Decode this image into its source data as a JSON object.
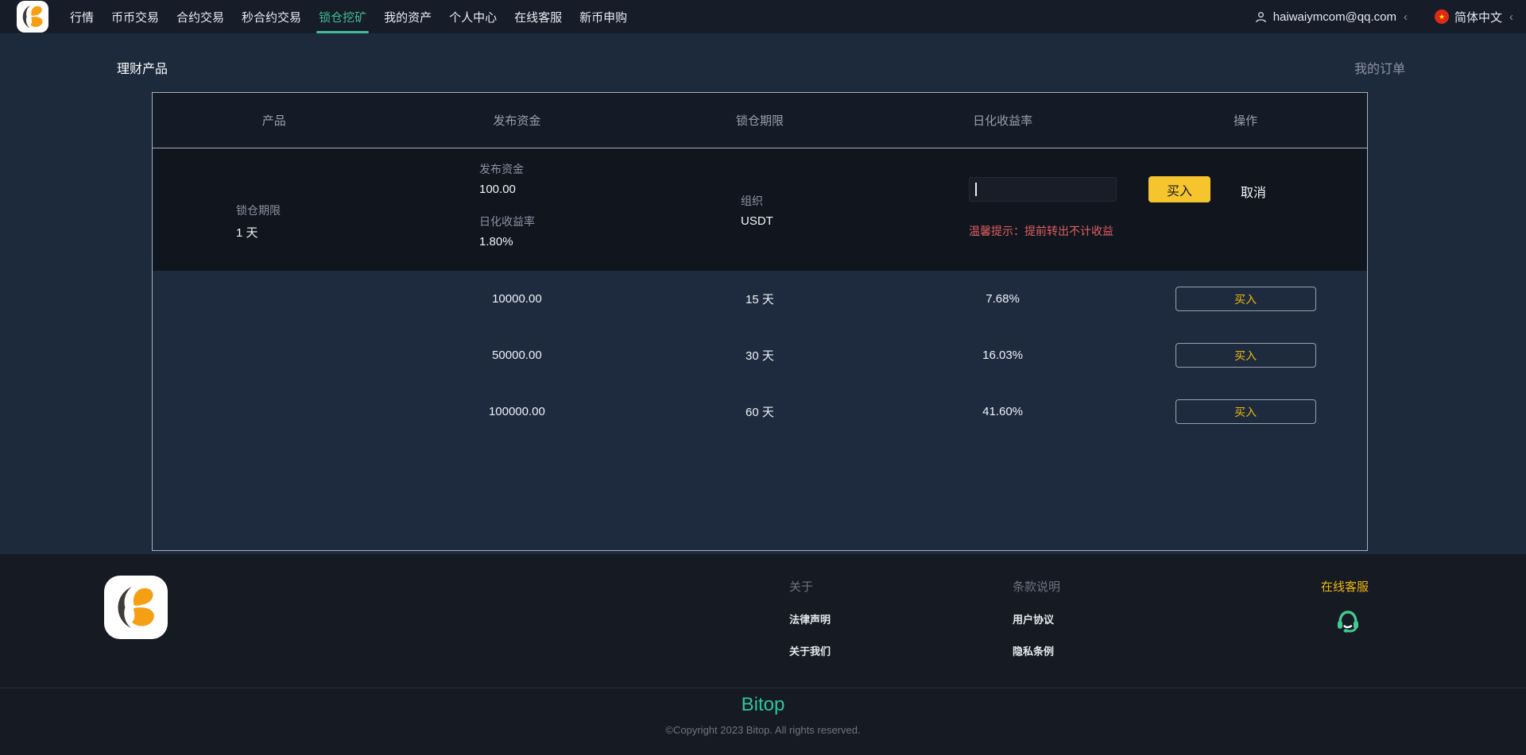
{
  "navbar": {
    "items": [
      {
        "label": "行情",
        "active": false
      },
      {
        "label": "币币交易",
        "active": false
      },
      {
        "label": "合约交易",
        "active": false
      },
      {
        "label": "秒合约交易",
        "active": false
      },
      {
        "label": "锁仓挖矿",
        "active": true
      },
      {
        "label": "我的资产",
        "active": false
      },
      {
        "label": "个人中心",
        "active": false
      },
      {
        "label": "在线客服",
        "active": false
      },
      {
        "label": "新币申购",
        "active": false
      }
    ],
    "user": {
      "email": "haiwaiymcom@qq.com",
      "chevron": "‹"
    },
    "language": {
      "label": "简体中文",
      "flag_star": "★",
      "chevron": "‹"
    }
  },
  "page": {
    "title": "理财产品",
    "orders_link": "我的订单"
  },
  "table": {
    "headers": [
      "产品",
      "发布资金",
      "锁仓期限",
      "日化收益率",
      "操作"
    ],
    "expanded": {
      "lock_period_label": "锁仓期限",
      "lock_period_value": "1 天",
      "publish_amount_label": "发布资金",
      "publish_amount_value": "100.00",
      "daily_rate_label": "日化收益率",
      "daily_rate_value": "1.80%",
      "org_label": "组织",
      "org_value": "USDT",
      "amount_input_value": "",
      "buy_label": "买入",
      "cancel_label": "取消",
      "warning": "温馨提示：提前转出不计收益"
    },
    "rows": [
      {
        "amount": "10000.00",
        "period": "15 天",
        "rate": "7.68%",
        "action": "买入"
      },
      {
        "amount": "50000.00",
        "period": "30 天",
        "rate": "16.03%",
        "action": "买入"
      },
      {
        "amount": "100000.00",
        "period": "60 天",
        "rate": "41.60%",
        "action": "买入"
      }
    ]
  },
  "footer": {
    "about": {
      "heading": "关于",
      "links": [
        "法律声明",
        "关于我们"
      ]
    },
    "terms": {
      "heading": "条款说明",
      "links": [
        "用户协议",
        "隐私条例"
      ]
    },
    "customer_service": "在线客服",
    "brand": "Bitop",
    "copyright": "©Copyright 2023 Bitop. All rights reserved."
  },
  "colors": {
    "accent_yellow": "#f6c52e",
    "accent_teal": "#3fbe95",
    "brand_teal": "#2fc4a0",
    "warning_red": "#e05f5f"
  }
}
